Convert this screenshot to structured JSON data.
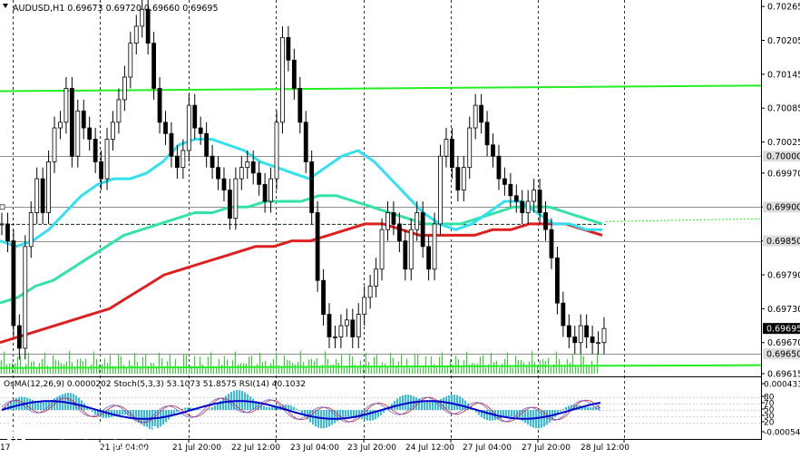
{
  "chart_data": {
    "type": "line",
    "symbol": "AUDUSD,H1",
    "ohlc_header": [
      "0.69673",
      "0.69720",
      "0.69660",
      "0.69695"
    ],
    "price_range": [
      0.69615,
      0.7027
    ],
    "price_ticks": [
      "0.70265",
      "0.70205",
      "0.70145",
      "0.70085",
      "0.70025",
      "0.69970",
      "0.69910",
      "0.69850",
      "0.69790",
      "0.69730",
      "0.69670",
      "0.69615"
    ],
    "price_tick_values": [
      0.70265,
      0.70205,
      0.70145,
      0.70085,
      0.70025,
      0.6997,
      0.6991,
      0.6985,
      0.6979,
      0.6973,
      0.6967,
      0.69615
    ],
    "level_labels": [
      {
        "text": "0.70000",
        "value": 0.7,
        "style": "gray"
      },
      {
        "text": "0.69900",
        "value": 0.6991,
        "style": "gray"
      },
      {
        "text": "0.69850",
        "value": 0.6985,
        "style": "gray"
      },
      {
        "text": "0.69695",
        "value": 0.69695,
        "style": "current"
      },
      {
        "text": "0.69650",
        "value": 0.6965,
        "style": "gray"
      }
    ],
    "hlines": [
      {
        "value": 0.7,
        "color": "#909090",
        "style": "solid"
      },
      {
        "value": 0.6991,
        "color": "#909090",
        "style": "solid"
      },
      {
        "value": 0.6985,
        "color": "#909090",
        "style": "solid"
      },
      {
        "value": 0.6965,
        "color": "#909090",
        "style": "solid"
      }
    ],
    "trendlines": [
      {
        "y_start": 0.70115,
        "y_end": 0.70125,
        "color": "#22ee22"
      },
      {
        "y_start": 0.69625,
        "y_end": 0.6963,
        "color": "#22ee22"
      }
    ],
    "x_labels": [
      "17",
      "21 Jul 04:00",
      "21 Jul 20:00",
      "22 Jul 12:00",
      "23 Jul 04:00",
      "23 Jul 20:00",
      "24 Jul 12:00",
      "27 Jul 04:00",
      "27 Jul 20:00",
      "28 Jul 12:00"
    ],
    "series_close": [
      0.6988,
      0.6985,
      0.697,
      0.6966,
      0.6984,
      0.699,
      0.6996,
      0.699,
      0.6999,
      0.7005,
      0.7006,
      0.7012,
      0.7,
      0.7008,
      0.7005,
      0.7003,
      0.6999,
      0.6996,
      0.7003,
      0.7006,
      0.701,
      0.7014,
      0.702,
      0.7023,
      0.7026,
      0.702,
      0.7012,
      0.7006,
      0.7004,
      0.7,
      0.6998,
      0.7001,
      0.7009,
      0.7005,
      0.7004,
      0.7,
      0.6998,
      0.6996,
      0.6994,
      0.6989,
      0.6996,
      0.6998,
      0.6999,
      0.6997,
      0.6995,
      0.6992,
      0.6996,
      0.7006,
      0.7021,
      0.7017,
      0.7012,
      0.7006,
      0.6999,
      0.699,
      0.6978,
      0.6972,
      0.6968,
      0.6968,
      0.697,
      0.6971,
      0.6968,
      0.6972,
      0.6975,
      0.6977,
      0.698,
      0.6987,
      0.699,
      0.6988,
      0.6985,
      0.698,
      0.6987,
      0.699,
      0.6984,
      0.698,
      0.6988,
      0.7,
      0.7003,
      0.6998,
      0.6994,
      0.6998,
      0.7005,
      0.7009,
      0.7006,
      0.7002,
      0.7,
      0.6996,
      0.6995,
      0.6993,
      0.6992,
      0.699,
      0.6992,
      0.6994,
      0.699,
      0.6987,
      0.6982,
      0.6974,
      0.697,
      0.6968,
      0.6967,
      0.697,
      0.6968,
      0.6967,
      0.6967,
      0.69695
    ],
    "sma_cyan": [
      0.6985,
      0.6984,
      0.6985,
      0.6987,
      0.699,
      0.6993,
      0.6995,
      0.6996,
      0.6996,
      0.6997,
      0.6999,
      0.7002,
      0.7003,
      0.7003,
      0.7002,
      0.7001,
      0.6999,
      0.6998,
      0.6997,
      0.6996,
      0.6998,
      0.7,
      0.7001,
      0.6999,
      0.6996,
      0.6993,
      0.699,
      0.6988,
      0.6987,
      0.6988,
      0.699,
      0.6992,
      0.6992,
      0.699,
      0.6988,
      0.6988,
      0.6987,
      0.6987
    ],
    "ema_green": [
      0.6974,
      0.6975,
      0.6977,
      0.6978,
      0.698,
      0.6982,
      0.6984,
      0.6986,
      0.6987,
      0.6988,
      0.6989,
      0.699,
      0.699,
      0.6991,
      0.6991,
      0.6992,
      0.6992,
      0.6992,
      0.6993,
      0.6993,
      0.6992,
      0.6991,
      0.699,
      0.6989,
      0.6988,
      0.6988,
      0.6988,
      0.6989,
      0.699,
      0.6991,
      0.6991,
      0.6991,
      0.699,
      0.6989,
      0.6988
    ],
    "ema_red": [
      0.6967,
      0.6968,
      0.6969,
      0.697,
      0.6971,
      0.6972,
      0.6973,
      0.6975,
      0.6977,
      0.6979,
      0.698,
      0.6981,
      0.6982,
      0.6983,
      0.6984,
      0.6984,
      0.6985,
      0.6985,
      0.6986,
      0.6987,
      0.6988,
      0.6988,
      0.6987,
      0.6986,
      0.6986,
      0.6986,
      0.6986,
      0.6987,
      0.6987,
      0.6988,
      0.6988,
      0.6988,
      0.6987,
      0.6986
    ],
    "indicator_header": [
      "OsMA(12,26,9) 0.0000202",
      "Stoch(5,3,3) 53.1073 51.8575",
      "RSI(14) 40.1032"
    ],
    "indicator_ticks": [
      "0.000433",
      "80",
      "70",
      "50",
      "30",
      "20",
      "-0.000541"
    ]
  },
  "watermark": {
    "brand": "instaforex",
    "tagline": "Instant Forex Trading"
  },
  "colors": {
    "price_line": "#000000",
    "sma_cyan": "#33e0f0",
    "ema_green": "#33e2a6",
    "ema_red": "#dd1f1f",
    "trend_green": "#22ee22",
    "volume": "#22dd22",
    "osma": "#33bde0",
    "stoch_main": "#0000cc",
    "stoch_signal": "#cc2222",
    "rsi": "#6666dd",
    "current_label_bg": "#000000",
    "level_label_bg": "#dddddd"
  }
}
